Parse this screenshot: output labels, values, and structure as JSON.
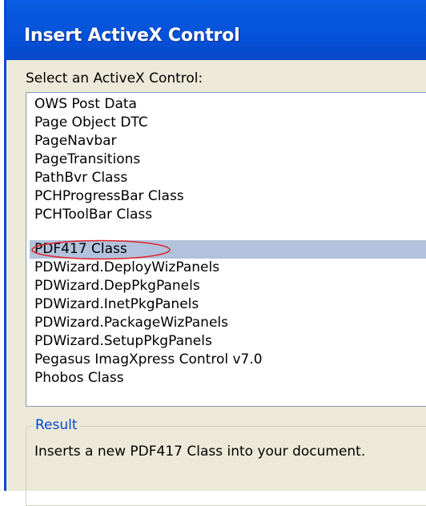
{
  "window": {
    "title": "Insert ActiveX Control"
  },
  "prompt_label": "Select an ActiveX Control:",
  "controls_list": {
    "items": [
      "OWS Post Data",
      "Page Object DTC",
      "PageNavbar",
      "PageTransitions",
      "PathBvr Class",
      "PCHProgressBar Class",
      "PCHToolBar Class",
      "PDF417 Class",
      "PDWizard.DeployWizPanels",
      "PDWizard.DepPkgPanels",
      "PDWizard.InetPkgPanels",
      "PDWizard.PackageWizPanels",
      "PDWizard.SetupPkgPanels",
      "Pegasus ImagXpress Control v7.0",
      "Phobos Class"
    ],
    "selected_index": 7
  },
  "result": {
    "legend": "Result",
    "description": "Inserts a new PDF417 Class into your document."
  },
  "colors": {
    "titlebar": "#0553da",
    "selection": "#b2c2dc",
    "annotation_circle": "#e0242a",
    "legend_text": "#0046d5"
  }
}
